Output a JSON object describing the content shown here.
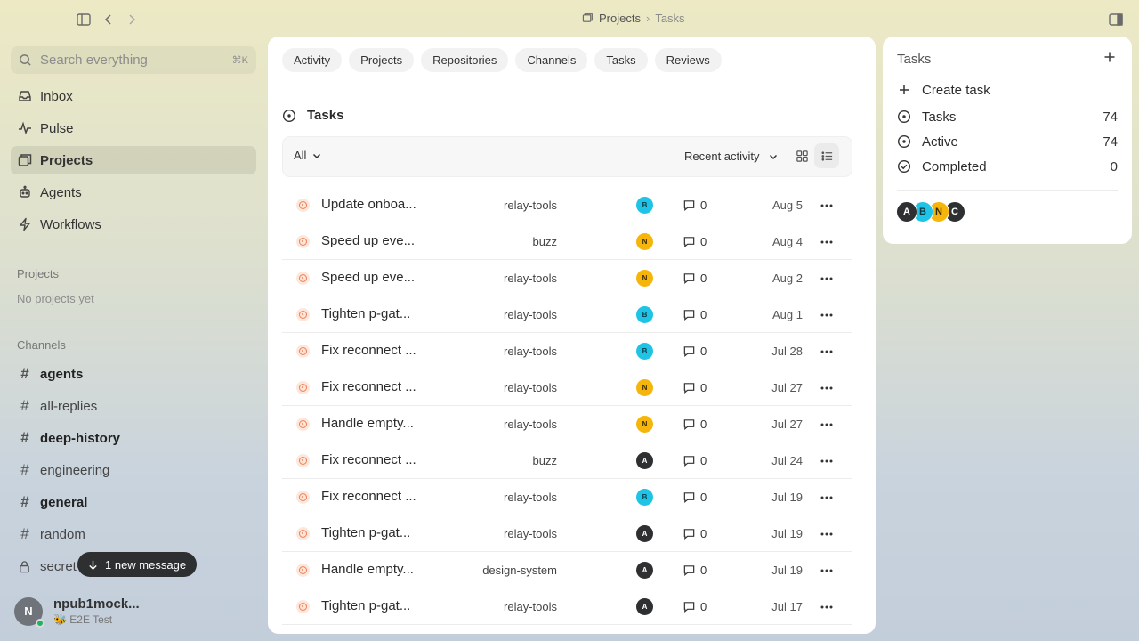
{
  "breadcrumb": {
    "parent": "Projects",
    "current": "Tasks"
  },
  "sidebar": {
    "search_placeholder": "Search everything",
    "search_shortcut": "⌘K",
    "nav": [
      {
        "label": "Inbox",
        "icon": "inbox-icon"
      },
      {
        "label": "Pulse",
        "icon": "pulse-icon"
      },
      {
        "label": "Projects",
        "icon": "projects-icon",
        "active": true
      },
      {
        "label": "Agents",
        "icon": "agents-icon"
      },
      {
        "label": "Workflows",
        "icon": "workflows-icon"
      }
    ],
    "projects_heading": "Projects",
    "projects_empty": "No projects yet",
    "channels_heading": "Channels",
    "channels": [
      {
        "name": "agents",
        "unread": true
      },
      {
        "name": "all-replies",
        "unread": false
      },
      {
        "name": "deep-history",
        "unread": true
      },
      {
        "name": "engineering",
        "unread": false
      },
      {
        "name": "general",
        "unread": true
      },
      {
        "name": "random",
        "unread": false
      },
      {
        "name": "secret-",
        "unread": false,
        "private": true
      }
    ],
    "toast": "1 new message",
    "user": {
      "initial": "N",
      "name": "npub1mock...",
      "status": "🐝 E2E Test"
    }
  },
  "main": {
    "tabs": [
      "Activity",
      "Projects",
      "Repositories",
      "Channels",
      "Tasks",
      "Reviews"
    ],
    "section_title": "Tasks",
    "filter_label": "All",
    "sort_label": "Recent activity",
    "tasks": [
      {
        "title": "Update onboa...",
        "project": "relay-tools",
        "assignee": "B",
        "comments": "0",
        "date": "Aug 5"
      },
      {
        "title": "Speed up eve...",
        "project": "buzz",
        "assignee": "N",
        "comments": "0",
        "date": "Aug 4"
      },
      {
        "title": "Speed up eve...",
        "project": "relay-tools",
        "assignee": "N",
        "comments": "0",
        "date": "Aug 2"
      },
      {
        "title": "Tighten p-gat...",
        "project": "relay-tools",
        "assignee": "B",
        "comments": "0",
        "date": "Aug 1"
      },
      {
        "title": "Fix reconnect ...",
        "project": "relay-tools",
        "assignee": "B",
        "comments": "0",
        "date": "Jul 28"
      },
      {
        "title": "Fix reconnect ...",
        "project": "relay-tools",
        "assignee": "N",
        "comments": "0",
        "date": "Jul 27"
      },
      {
        "title": "Handle empty...",
        "project": "relay-tools",
        "assignee": "N",
        "comments": "0",
        "date": "Jul 27"
      },
      {
        "title": "Fix reconnect ...",
        "project": "buzz",
        "assignee": "A",
        "comments": "0",
        "date": "Jul 24"
      },
      {
        "title": "Fix reconnect ...",
        "project": "relay-tools",
        "assignee": "B",
        "comments": "0",
        "date": "Jul 19"
      },
      {
        "title": "Tighten p-gat...",
        "project": "relay-tools",
        "assignee": "A",
        "comments": "0",
        "date": "Jul 19"
      },
      {
        "title": "Handle empty...",
        "project": "design-system",
        "assignee": "A",
        "comments": "0",
        "date": "Jul 19"
      },
      {
        "title": "Tighten p-gat...",
        "project": "relay-tools",
        "assignee": "A",
        "comments": "0",
        "date": "Jul 17"
      }
    ]
  },
  "right_panel": {
    "title": "Tasks",
    "create_label": "Create task",
    "stats": [
      {
        "label": "Tasks",
        "value": "74",
        "icon": "circle-dot-icon"
      },
      {
        "label": "Active",
        "value": "74",
        "icon": "circle-dot-icon"
      },
      {
        "label": "Completed",
        "value": "0",
        "icon": "circle-check-icon"
      }
    ],
    "members": [
      "A",
      "B",
      "N",
      "C"
    ]
  },
  "colors": {
    "avatar_A": "#2d2f31",
    "avatar_B": "#1ec3e6",
    "avatar_N": "#f5b50a",
    "avatar_C": "#2d2f31",
    "status_open": "#ef7d4f",
    "online": "#22b45a"
  }
}
